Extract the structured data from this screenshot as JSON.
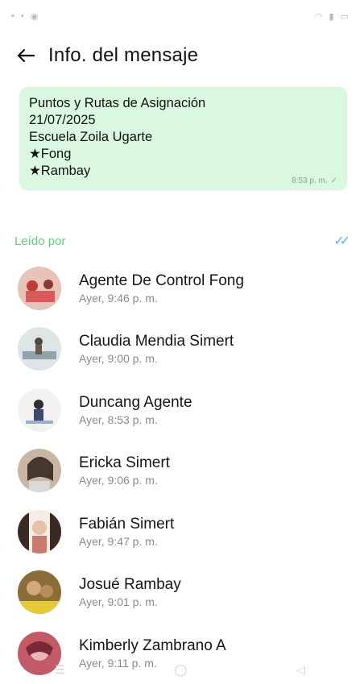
{
  "header": {
    "title": "Info. del mensaje"
  },
  "message": {
    "lines": [
      "Puntos y Rutas de Asignación",
      "21/07/2025",
      "Escuela Zoila Ugarte",
      "★Fong",
      "★Rambay"
    ],
    "time": "8:53 p. m."
  },
  "read_by": {
    "title": "Leído por",
    "people": [
      {
        "name": "Agente De Control Fong",
        "time": "Ayer, 9:46 p. m."
      },
      {
        "name": "Claudia Mendia Simert",
        "time": "Ayer, 9:00 p. m."
      },
      {
        "name": "Duncang Agente",
        "time": "Ayer, 8:53 p. m."
      },
      {
        "name": "Ericka Simert",
        "time": "Ayer, 9:06 p. m."
      },
      {
        "name": "Fabián Simert",
        "time": "Ayer, 9:47 p. m."
      },
      {
        "name": "Josué Rambay",
        "time": "Ayer, 9:01 p. m."
      },
      {
        "name": "Kimberly Zambrano A",
        "time": "Ayer, 9:11 p. m."
      }
    ]
  },
  "colors": {
    "bubble": "#d9f8df",
    "section_title": "#5ccf7b",
    "read_ticks": "#53b8f0"
  }
}
